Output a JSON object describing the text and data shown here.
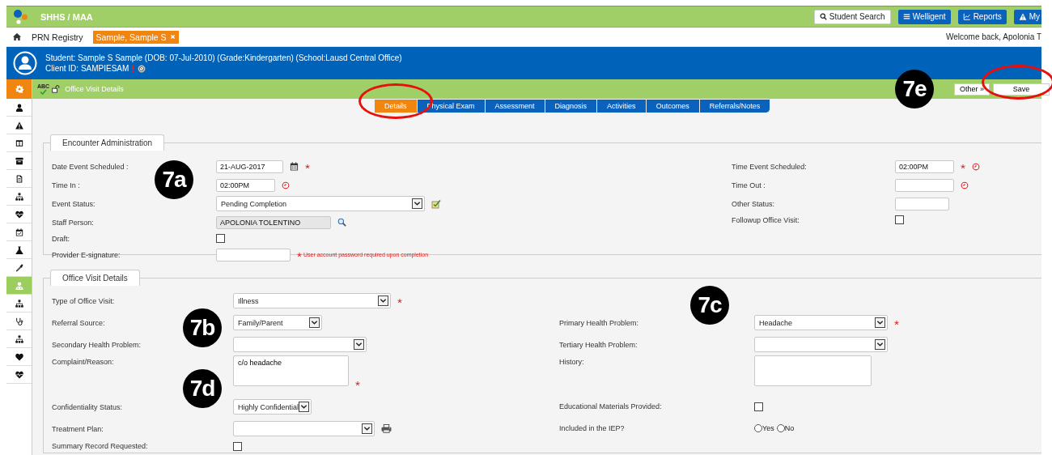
{
  "header": {
    "title": "SHHS / MAA",
    "buttons": [
      {
        "label": "Student Search",
        "kind": "search"
      },
      {
        "label": "Welligent",
        "kind": "menu"
      },
      {
        "label": "Reports",
        "kind": "chart"
      },
      {
        "label": "My",
        "kind": "warning"
      }
    ]
  },
  "breadcrumb": {
    "items": [
      {
        "label": "PRN Registry",
        "selected": false
      },
      {
        "label": "Sample, Sample S",
        "selected": true
      }
    ],
    "welcome": "Welcome back, Apolonia T"
  },
  "student": {
    "line1": "Student: Sample S Sample (DOB: 07-Jul-2010) (Grade:Kindergarten) (School:Lausd Central Office)",
    "line2": "Client ID: SAMPIESAM"
  },
  "toolbar": {
    "spellcheck": "ABC",
    "title": "Office Visit Details",
    "buttons": [
      "Other »",
      "Save"
    ]
  },
  "sidebar": {
    "items": [
      {
        "kind": "gear",
        "selected": false
      },
      {
        "kind": "user",
        "selected": false
      },
      {
        "kind": "warning",
        "selected": false
      },
      {
        "kind": "columns",
        "selected": false
      },
      {
        "kind": "archive",
        "selected": false
      },
      {
        "kind": "document",
        "selected": false
      },
      {
        "kind": "sitemap",
        "selected": false
      },
      {
        "kind": "heartbeat",
        "selected": false
      },
      {
        "kind": "calendar",
        "selected": false
      },
      {
        "kind": "flask",
        "selected": false
      },
      {
        "kind": "dropper",
        "selected": false
      },
      {
        "kind": "doctor",
        "selected": true
      },
      {
        "kind": "sitemap",
        "selected": false
      },
      {
        "kind": "stethoscope",
        "selected": false
      },
      {
        "kind": "sitemap",
        "selected": false
      },
      {
        "kind": "heart",
        "selected": false
      },
      {
        "kind": "heartbeat",
        "selected": false
      }
    ]
  },
  "tabs": [
    {
      "label": "Details",
      "selected": true
    },
    {
      "label": "Physical Exam",
      "selected": false
    },
    {
      "label": "Assessment",
      "selected": false
    },
    {
      "label": "Diagnosis",
      "selected": false
    },
    {
      "label": "Activities",
      "selected": false
    },
    {
      "label": "Outcomes",
      "selected": false
    },
    {
      "label": "Referrals/Notes",
      "selected": false
    }
  ],
  "sections": [
    {
      "title": "Encounter Administration",
      "left": [
        {
          "label": "Date Event Scheduled :",
          "kind": "text",
          "value": "21-AUG-2017",
          "button": {
            "kind": "date-picker"
          },
          "required": true
        },
        {
          "label": "Time In :",
          "kind": "text",
          "value": "02:00PM",
          "button": {
            "kind": "time-picker"
          },
          "required": false
        },
        {
          "label": "Event Status:",
          "kind": "select",
          "value": "Pending Completion",
          "button": {
            "kind": "confirm"
          },
          "required": false
        },
        {
          "label": "Staff Person:",
          "kind": "readonly",
          "value": "APOLONIA TOLENTINO",
          "button": {
            "kind": "lookup"
          },
          "required": false
        },
        {
          "label": "Draft:",
          "kind": "checkbox",
          "checked": false
        },
        {
          "label": "Provider E-signature:",
          "kind": "text",
          "required": true,
          "note": "User account password required upon completion"
        }
      ],
      "right": [
        {
          "label": "Time Event Scheduled:",
          "kind": "text",
          "value": "02:00PM",
          "button": {
            "kind": "time-picker"
          },
          "required": true
        },
        {
          "label": "Time Out :",
          "kind": "text",
          "button": {
            "kind": "time-picker"
          },
          "required": false
        },
        {
          "label": "Other Status:",
          "kind": "text",
          "required": false
        },
        {
          "label": "Followup Office Visit:",
          "kind": "checkbox",
          "checked": false
        }
      ]
    },
    {
      "title": "Office Visit Details",
      "left": [
        {
          "label": "Type of Office Visit:",
          "kind": "select",
          "value": "Illness",
          "required": true
        },
        {
          "label": "Referral Source:",
          "kind": "select",
          "value": "Family/Parent",
          "required": false
        },
        {
          "label": "Secondary Health Problem:",
          "kind": "select",
          "required": false
        },
        {
          "label": "Complaint/Reason:",
          "kind": "textarea",
          "value": "c/o headache",
          "required": true
        },
        {
          "label": "Confidentiality Status:",
          "kind": "select",
          "value": "Highly Confidential",
          "required": false
        },
        {
          "label": "Treatment Plan:",
          "kind": "select",
          "button": {
            "kind": "print"
          },
          "required": false
        },
        {
          "label": "Summary Record Requested:",
          "kind": "checkbox",
          "checked": false
        }
      ],
      "right": [
        {
          "label": "Primary Health Problem:",
          "kind": "select",
          "value": "Headache",
          "required": true
        },
        {
          "label": "Tertiary Health Problem:",
          "kind": "select",
          "required": false
        },
        {
          "label": "History:",
          "kind": "textarea",
          "required": false
        },
        {
          "label": "Educational Materials Provided:",
          "kind": "checkbox",
          "checked": false
        },
        {
          "label": "Included in the IEP?",
          "kind": "radio",
          "options": [
            {
              "label": "Yes",
              "selected": false
            },
            {
              "label": "No",
              "selected": false
            }
          ]
        }
      ]
    }
  ],
  "callouts": [
    {
      "label": "7a"
    },
    {
      "label": "7b"
    },
    {
      "label": "7c"
    },
    {
      "label": "7d"
    },
    {
      "label": "7e"
    }
  ]
}
